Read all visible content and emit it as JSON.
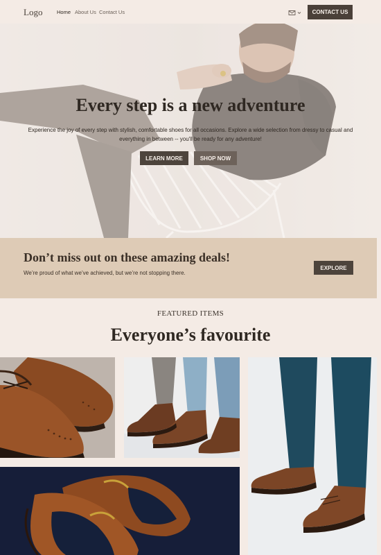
{
  "nav": {
    "logo": "Logo",
    "links": [
      "Home",
      "About Us",
      "Contact Us"
    ],
    "contact_button": "CONTACT US",
    "cart_icon": "cart-icon",
    "dropdown_icon": "chevron-down-icon"
  },
  "hero": {
    "title": "Every step is a new adventure",
    "text": "Experience the joy of every step with stylish, comfortable shoes for all occasions. Explore a wide selection from dressy to casual and everything in between -- you'll be ready for any adventure!",
    "learn_more": "LEARN MORE",
    "shop_now": "SHOP NOW"
  },
  "deals": {
    "title": "Don’t miss out on these amazing deals!",
    "text": "We’re proud of what we’ve achieved, but we’re not stopping there.",
    "button": "EXPLORE"
  },
  "featured": {
    "eyebrow": "FEATURED ITEMS",
    "title": "Everyone’s favourite"
  },
  "colors": {
    "background": "#f4ebe5",
    "primary_button": "#4d443c",
    "secondary_button": "#6d625a",
    "deals_band": "#decbb6",
    "leather_brown": "#8a4a22"
  }
}
